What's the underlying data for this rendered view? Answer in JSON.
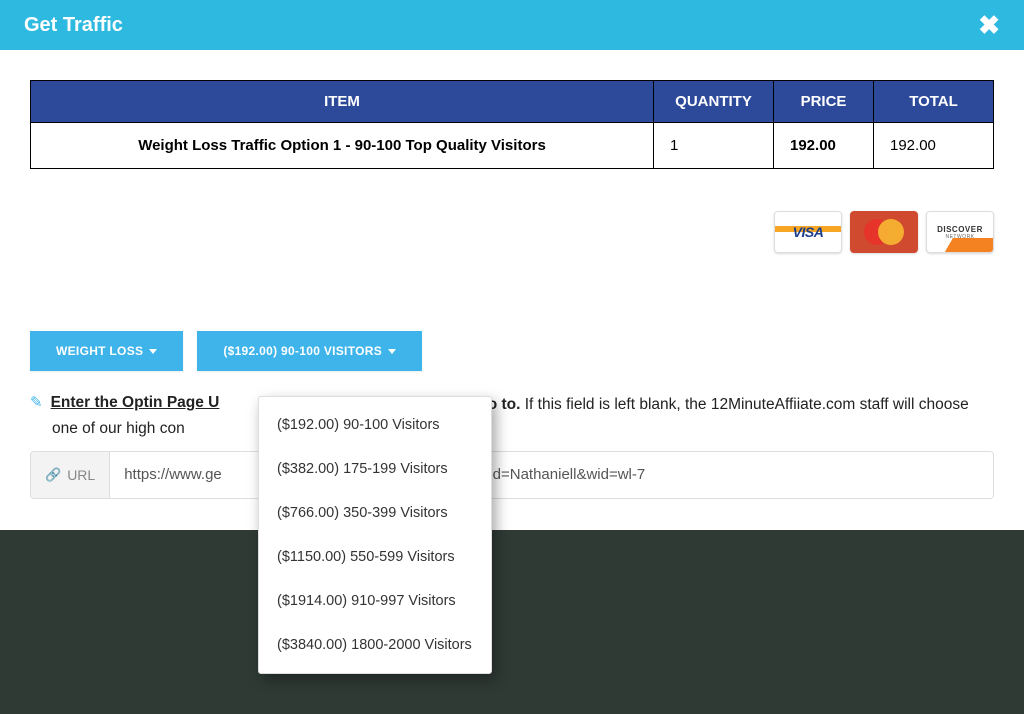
{
  "header": {
    "title": "Get Traffic"
  },
  "table": {
    "headers": {
      "item": "ITEM",
      "qty": "QUANTITY",
      "price": "PRICE",
      "total": "TOTAL"
    },
    "row": {
      "item": "Weight Loss Traffic Option 1 - 90-100 Top Quality Visitors",
      "qty": "1",
      "price": "192.00",
      "total": "192.00"
    }
  },
  "cards": {
    "visa": "VISA",
    "mastercard": "Mastercard",
    "discover": "DISCOVER",
    "discover_sub": "NETWORK"
  },
  "buttons": {
    "category": "WEIGHT LOSS",
    "package": "($192.00) 90-100 VISITORS"
  },
  "instruction": {
    "bold_prefix": "Enter the Optin Page U",
    "bold_suffix": "to go to.",
    "rest": " If this field is left blank, the 12MinuteAffiiate.com staff will choose one of our high con"
  },
  "url": {
    "label": "URL",
    "value": "https://www.ge                                                          tin&id=Nathaniell&wid=wl-7"
  },
  "dropdown": {
    "items": [
      "($192.00) 90-100 Visitors",
      "($382.00) 175-199 Visitors",
      "($766.00) 350-399 Visitors",
      "($1150.00) 550-599 Visitors",
      "($1914.00) 910-997 Visitors",
      "($3840.00) 1800-2000 Visitors"
    ]
  }
}
